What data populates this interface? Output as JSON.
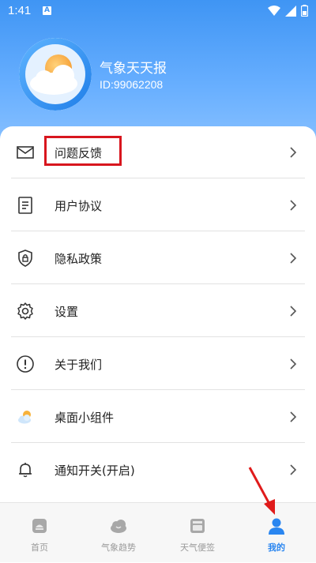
{
  "status_bar": {
    "time": "1:41",
    "notification_letter": "A"
  },
  "profile": {
    "app_name": "气象天天报",
    "user_id": "ID:99062208"
  },
  "menu": {
    "items": [
      {
        "label": "问题反馈",
        "icon": "mail-icon"
      },
      {
        "label": "用户协议",
        "icon": "document-icon"
      },
      {
        "label": "隐私政策",
        "icon": "shield-lock-icon"
      },
      {
        "label": "设置",
        "icon": "gear-icon"
      },
      {
        "label": "关于我们",
        "icon": "info-circle-icon"
      },
      {
        "label": "桌面小组件",
        "icon": "weather-widget-icon"
      },
      {
        "label": "通知开关(开启)",
        "icon": "bell-icon"
      }
    ]
  },
  "tabbar": {
    "tabs": [
      {
        "label": "首页",
        "icon": "home-icon"
      },
      {
        "label": "气象趋势",
        "icon": "cloud-icon"
      },
      {
        "label": "天气便签",
        "icon": "note-icon"
      },
      {
        "label": "我的",
        "icon": "person-icon"
      }
    ],
    "active_index": 3
  },
  "colors": {
    "header_top": "#3f95f4",
    "accent": "#2a86f0",
    "highlight_box": "#d8161e",
    "tab_inactive": "#9a9a9a"
  }
}
